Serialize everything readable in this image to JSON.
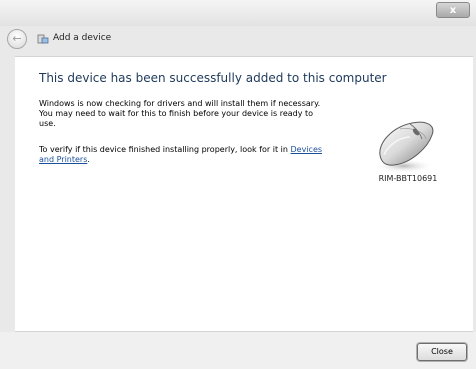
{
  "window": {
    "close_glyph": "x",
    "back_glyph": "←"
  },
  "nav": {
    "title": "Add a device"
  },
  "content": {
    "heading": "This device has been successfully added to this computer",
    "para1": "Windows is now checking for drivers and will install them if necessary. You may need to wait for this to finish before your device is ready to use.",
    "para2_text": "To verify if this device finished installing properly, look for it in ",
    "para2_link": "Devices and Printers",
    "para2_end": ".",
    "device_label": "RIM-BBT10691",
    "device_icon": "mouse-icon"
  },
  "footer": {
    "close_label": "Close"
  }
}
